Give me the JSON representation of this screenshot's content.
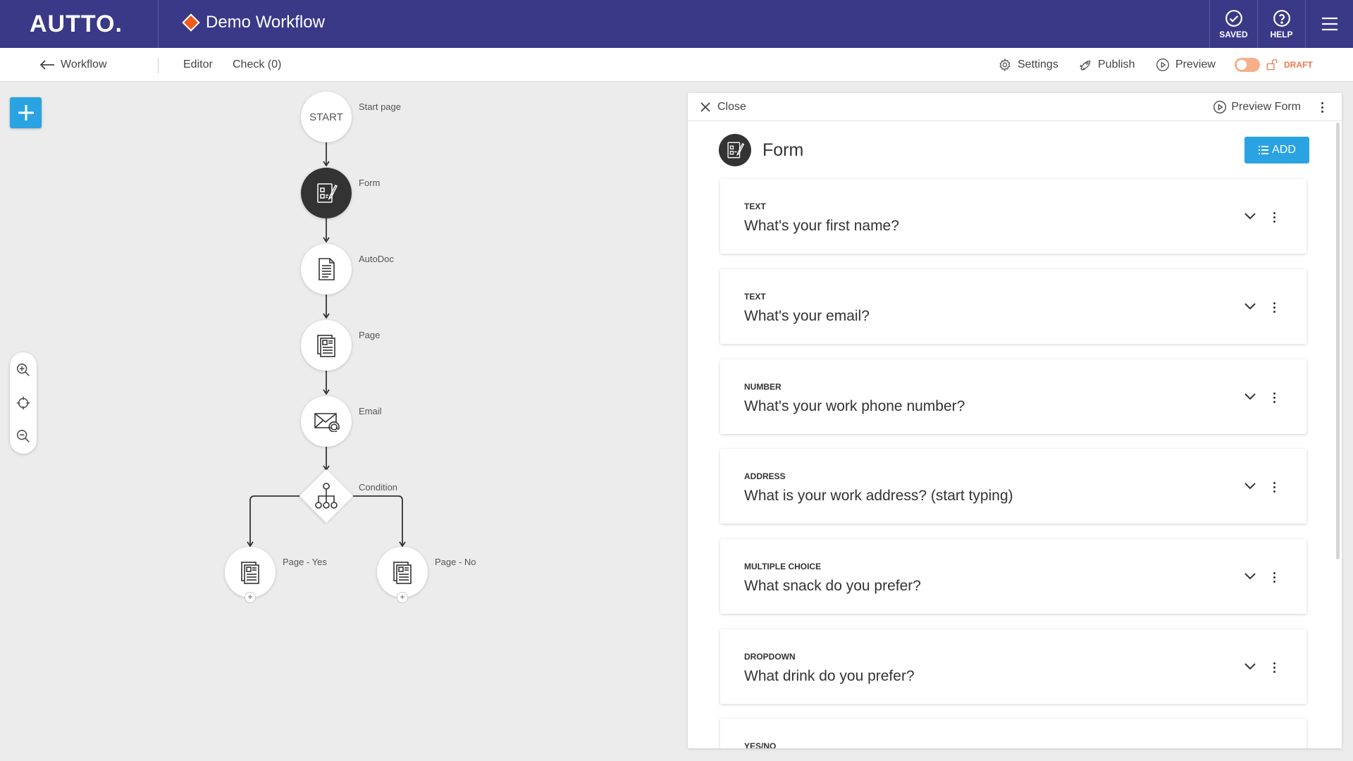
{
  "topbar": {
    "logo": "AUTTO.",
    "workflow_title": "Demo Workflow",
    "saved_label": "SAVED",
    "help_label": "HELP"
  },
  "subbar": {
    "back_label": "Workflow",
    "editor_label": "Editor",
    "check_label": "Check (0)",
    "settings_label": "Settings",
    "publish_label": "Publish",
    "preview_label": "Preview",
    "status_label": "DRAFT"
  },
  "flow": {
    "start_text": "START",
    "nodes": [
      {
        "label": "Start page"
      },
      {
        "label": "Form"
      },
      {
        "label": "AutoDoc"
      },
      {
        "label": "Page"
      },
      {
        "label": "Email"
      },
      {
        "label": "Condition"
      },
      {
        "label": "Page - Yes"
      },
      {
        "label": "Page - No"
      }
    ],
    "plus_symbol": "+"
  },
  "panel": {
    "close_label": "Close",
    "preview_form_label": "Preview Form",
    "form_title": "Form",
    "add_label": "ADD",
    "questions": [
      {
        "type": "TEXT",
        "question": "What's your first name?"
      },
      {
        "type": "TEXT",
        "question": "What's your email?"
      },
      {
        "type": "NUMBER",
        "question": "What's your work phone number?"
      },
      {
        "type": "ADDRESS",
        "question": "What is your work address? (start typing)"
      },
      {
        "type": "MULTIPLE CHOICE",
        "question": "What snack do you prefer?"
      },
      {
        "type": "DROPDOWN",
        "question": "What drink do you prefer?"
      },
      {
        "type": "YES/NO",
        "question": ""
      }
    ]
  },
  "colors": {
    "topbar": "#3a3988",
    "accent_blue": "#2aa3e2",
    "diamond_orange": "#f05a1a",
    "draft_orange": "#f07a4a"
  }
}
